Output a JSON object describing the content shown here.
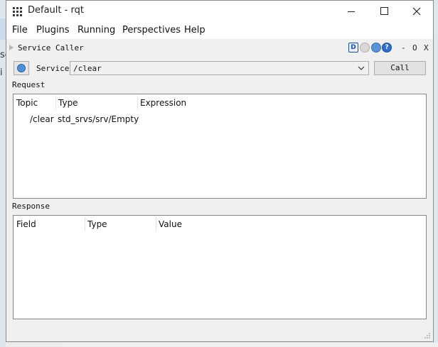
{
  "window": {
    "title": "Default - rqt"
  },
  "background_text": {
    "line1": "se",
    "line2": "i"
  },
  "menu": [
    {
      "label": "File",
      "name": "menu-file"
    },
    {
      "label": "Plugins",
      "name": "menu-plugins"
    },
    {
      "label": "Running",
      "name": "menu-running"
    },
    {
      "label": "Perspectives",
      "name": "menu-perspectives"
    },
    {
      "label": "Help",
      "name": "menu-help"
    }
  ],
  "plugin": {
    "title": "Service Caller",
    "d_icon_label": "D",
    "help_icon_label": "?",
    "minimize_label": "-",
    "float_label": "O",
    "close_label": "X"
  },
  "service": {
    "label": "Service",
    "value": "/clear",
    "call_label": "Call"
  },
  "request": {
    "section_label": "Request",
    "columns": [
      "Topic",
      "Type",
      "Expression"
    ],
    "rows": [
      {
        "topic": "/clear",
        "type": "std_srvs/srv/Empty",
        "expression": ""
      }
    ]
  },
  "response": {
    "section_label": "Response",
    "columns": [
      "Field",
      "Type",
      "Value"
    ]
  },
  "icons": [
    "apps-grid-icon",
    "minimize-icon",
    "maximize-icon",
    "close-icon",
    "collapse-triangle-icon",
    "d-icon",
    "gear-icon",
    "refresh-icon",
    "help-icon",
    "chevron-down-icon",
    "resize-grip-icon"
  ],
  "colors": {
    "window_bg": "#f0f0f0",
    "panel_bg": "#ffffff",
    "desktop": "#dfe7ee",
    "accent": "#2f6fc7"
  }
}
